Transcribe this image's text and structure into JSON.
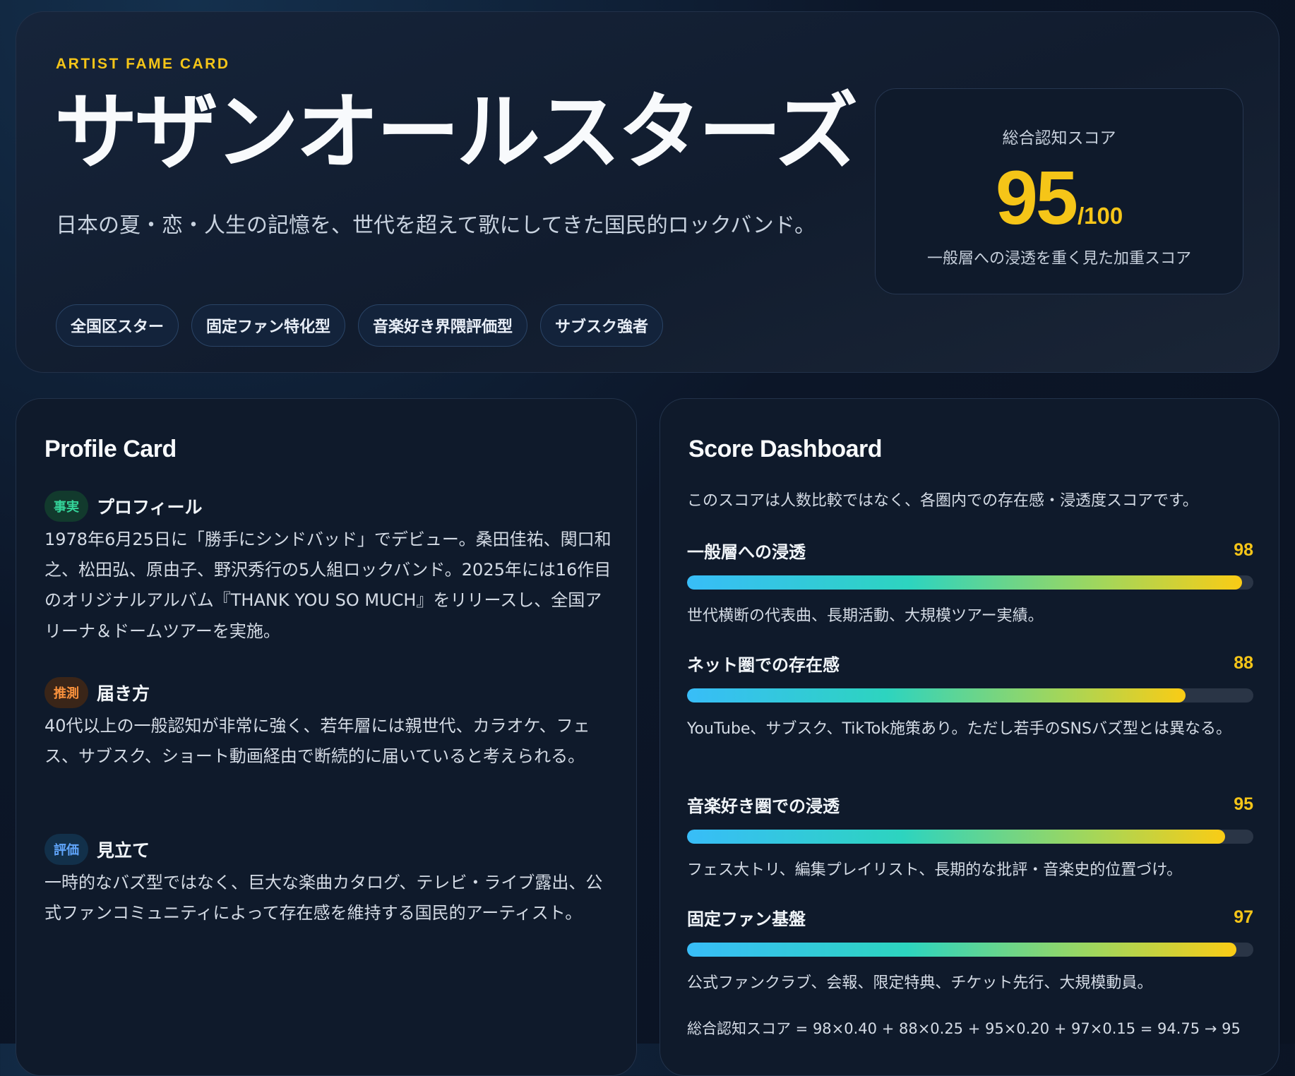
{
  "hero": {
    "eyebrow": "ARTIST FAME CARD",
    "title": "サザンオールスターズ",
    "subtitle": "日本の夏・恋・人生の記憶を、世代を超えて歌にしてきた国民的ロックバンド。",
    "tags": [
      "全国区スター",
      "固定ファン特化型",
      "音楽好き界隈評価型",
      "サブスク強者"
    ]
  },
  "score": {
    "label": "総合認知スコア",
    "value": "95",
    "max": "/100",
    "note": "一般層への浸透を重く見た加重スコア"
  },
  "profile": {
    "title": "Profile Card",
    "sections": [
      {
        "badge": "事実",
        "title": "プロフィール",
        "body": "1978年6月25日に「勝手にシンドバッド」でデビュー。桑田佳祐、関口和之、松田弘、原由子、野沢秀行の5人組ロックバンド。2025年には16作目のオリジナルアルバム『THANK YOU SO MUCH』をリリースし、全国アリーナ＆ドームツアーを実施。"
      },
      {
        "badge": "推測",
        "title": "届き方",
        "body": "40代以上の一般認知が非常に強く、若年層には親世代、カラオケ、フェス、サブスク、ショート動画経由で断続的に届いていると考えられる。"
      },
      {
        "badge": "評価",
        "title": "見立て",
        "body": "一時的なバズ型ではなく、巨大な楽曲カタログ、テレビ・ライブ露出、公式ファンコミュニティによって存在感を維持する国民的アーティスト。"
      }
    ]
  },
  "dashboard": {
    "title": "Score Dashboard",
    "intro": "このスコアは人数比較ではなく、各圏内での存在感・浸透度スコアです。",
    "metrics": [
      {
        "name": "一般層への浸透",
        "score": 98,
        "desc": "世代横断の代表曲、長期活動、大規模ツアー実績。"
      },
      {
        "name": "ネット圏での存在感",
        "score": 88,
        "desc": "YouTube、サブスク、TikTok施策あり。ただし若手のSNSバズ型とは異なる。"
      },
      {
        "name": "音楽好き圏での浸透",
        "score": 95,
        "desc": "フェス大トリ、編集プレイリスト、長期的な批評・音楽史的位置づけ。"
      },
      {
        "name": "固定ファン基盤",
        "score": 97,
        "desc": "公式ファンクラブ、会報、限定特典、チケット先行、大規模動員。"
      }
    ],
    "formula": "総合認知スコア = 98×0.40 + 88×0.25 + 95×0.20 + 97×0.15 = 94.75 → 95"
  }
}
